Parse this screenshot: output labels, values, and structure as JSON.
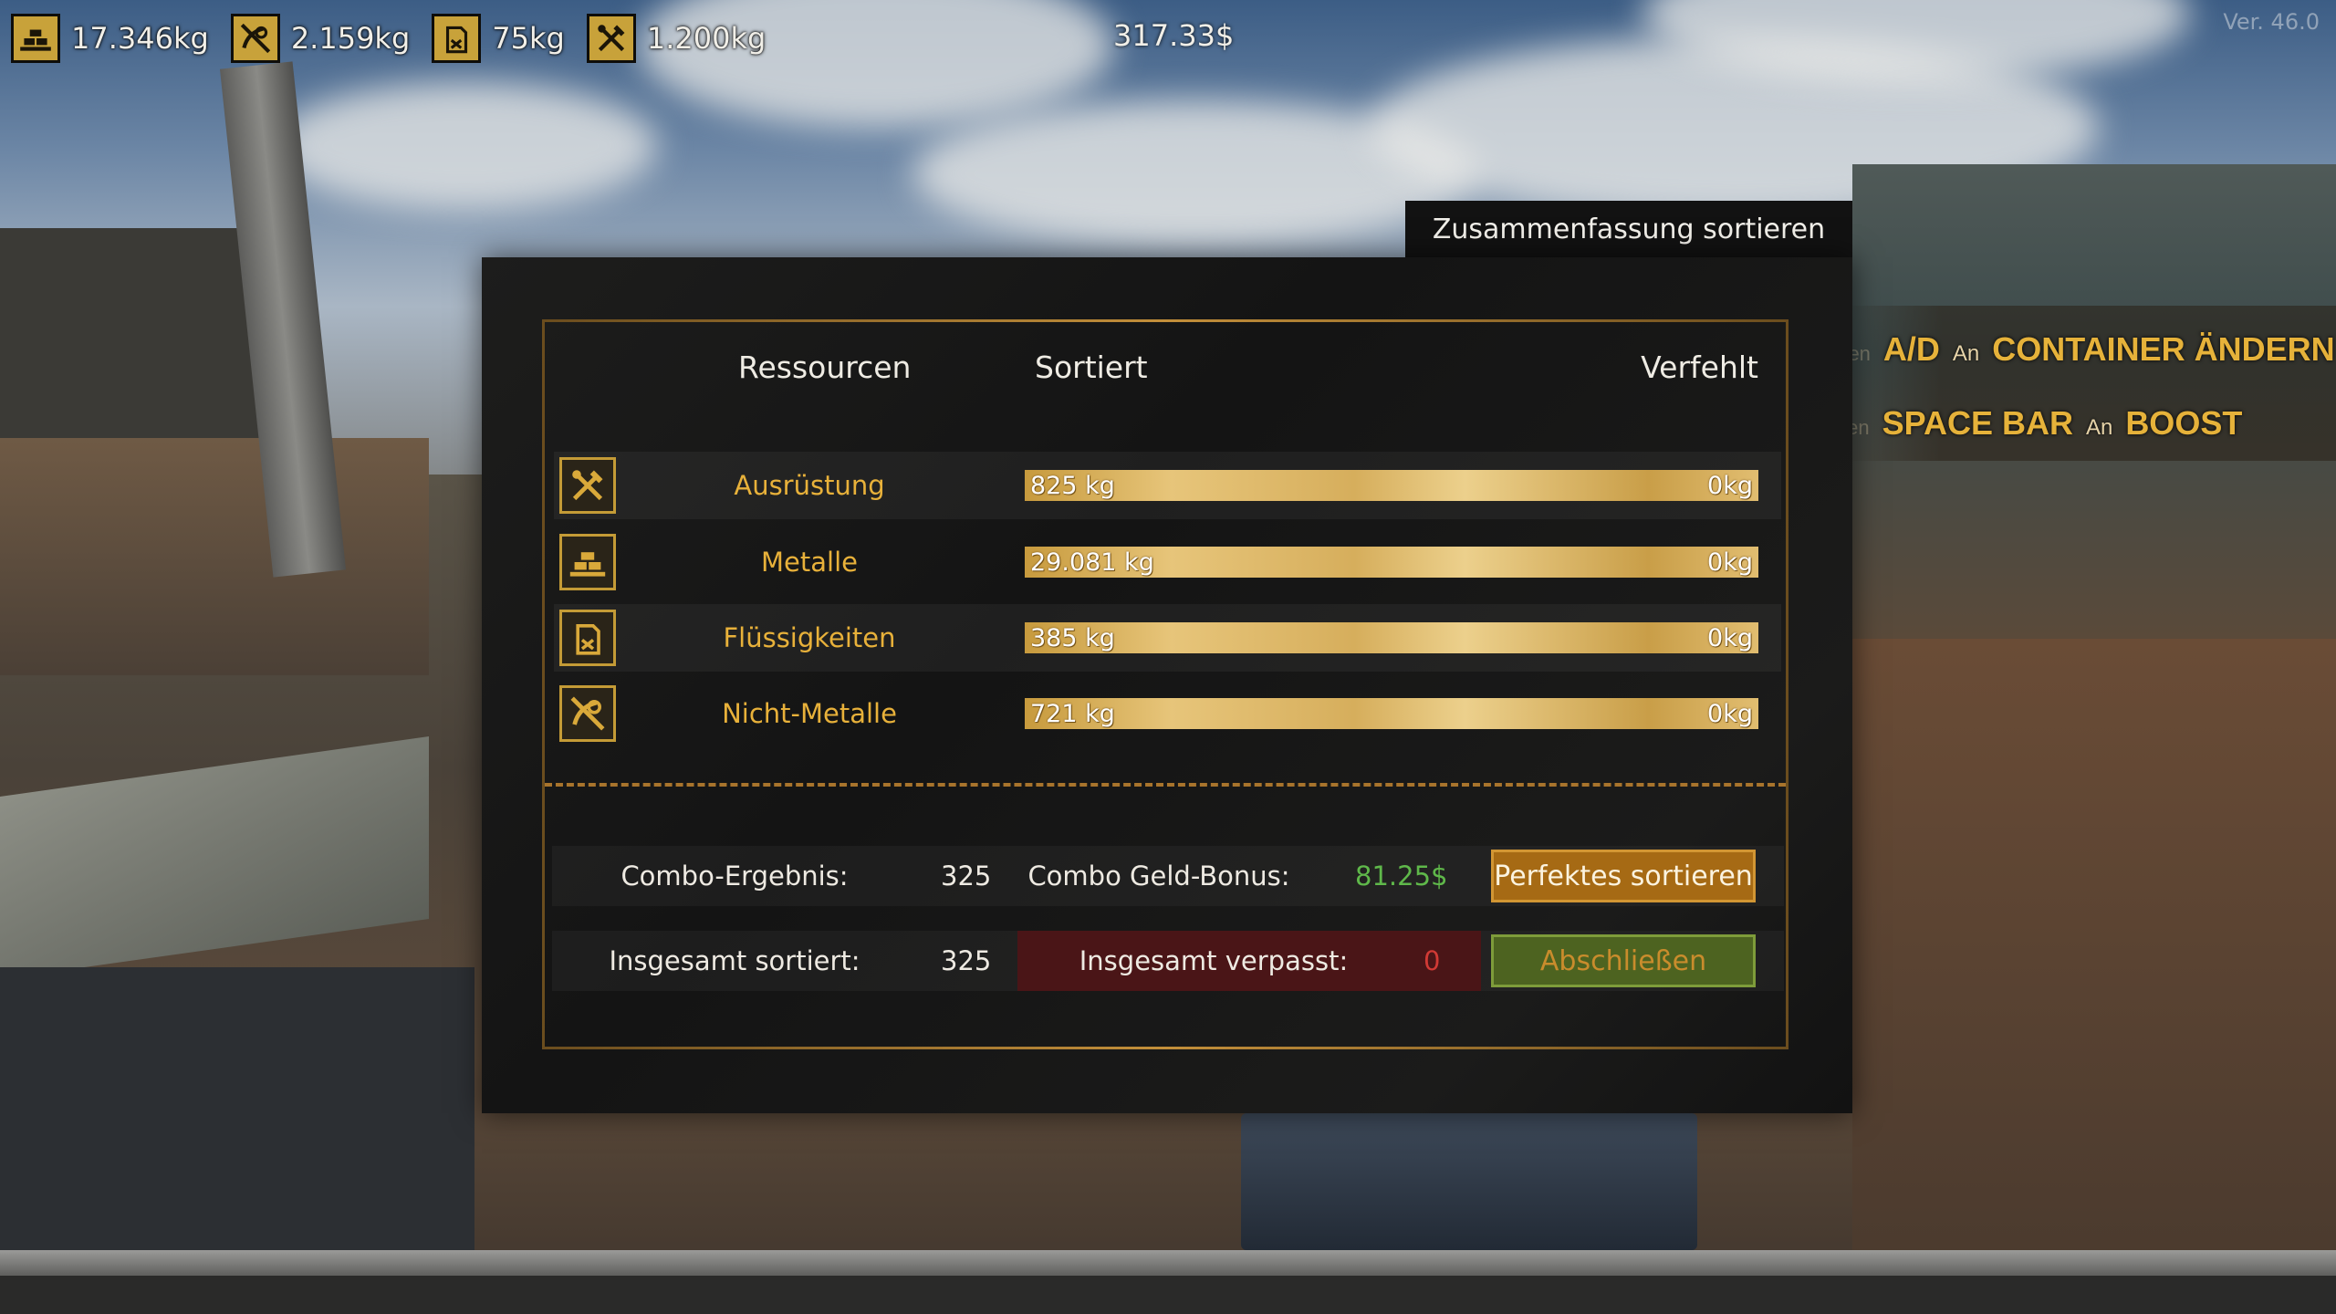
{
  "hud": {
    "resources": [
      {
        "icon": "metal-bars-icon",
        "value": "17.346kg"
      },
      {
        "icon": "non-metal-icon",
        "value": "2.159kg"
      },
      {
        "icon": "liquid-canister-icon",
        "value": "75kg"
      },
      {
        "icon": "tools-icon",
        "value": "1.200kg"
      }
    ],
    "money": "317.33$",
    "version": "Ver. 46.0"
  },
  "hints": [
    {
      "fade": "Drücken",
      "key": "A/D",
      "connector": "An",
      "action": "CONTAINER ÄNDERN"
    },
    {
      "fade": "Halten",
      "key": "SPACE BAR",
      "connector": "An",
      "action": "BOOST"
    }
  ],
  "summary": {
    "title": "Zusammenfassung sortieren",
    "headers": {
      "resources": "Ressourcen",
      "sorted": "Sortiert",
      "missed": "Verfehlt"
    },
    "rows": [
      {
        "icon": "tools-icon",
        "name": "Ausrüstung",
        "sorted": "825 kg",
        "missed": "0kg"
      },
      {
        "icon": "metal-bars-icon",
        "name": "Metalle",
        "sorted": "29.081 kg",
        "missed": "0kg"
      },
      {
        "icon": "liquid-canister-icon",
        "name": "Flüssigkeiten",
        "sorted": "385 kg",
        "missed": "0kg"
      },
      {
        "icon": "non-metal-icon",
        "name": "Nicht-Metalle",
        "sorted": "721 kg",
        "missed": "0kg"
      }
    ],
    "combo_label": "Combo-Ergebnis:",
    "combo_value": "325",
    "bonus_label": "Combo Geld-Bonus:",
    "bonus_value": "81.25$",
    "perfect_button": "Perfektes sortieren",
    "total_sorted_label": "Insgesamt sortiert:",
    "total_sorted_value": "325",
    "total_missed_label": "Insgesamt verpasst:",
    "total_missed_value": "0",
    "finish_button": "Abschließen"
  },
  "colors": {
    "accent": "#e8b13a",
    "bonus": "#5fb84a",
    "missed": "#d13a35",
    "panel": "#161616"
  }
}
